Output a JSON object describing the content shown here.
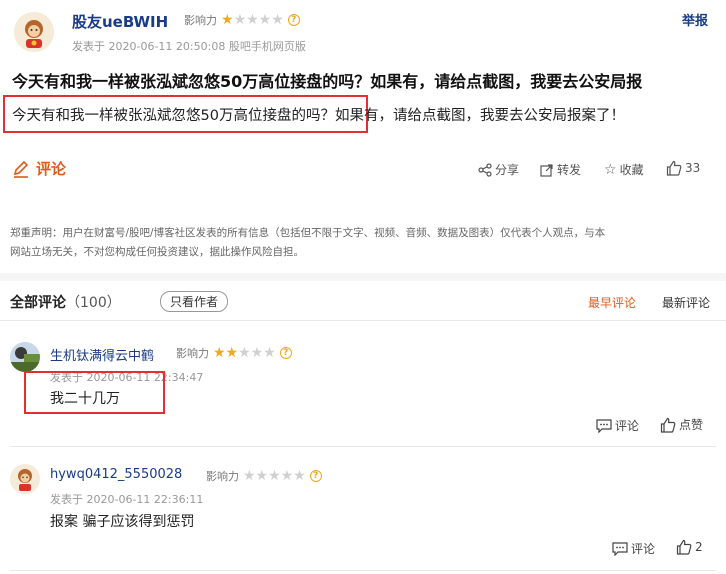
{
  "post": {
    "username": "股友ueBWIH",
    "influence_label": "影响力",
    "stars_on": 1,
    "stars_total": 5,
    "meta": "发表于 2020-06-11 20:50:08 股吧手机网页版",
    "report": "举报",
    "title": "今天有和我一样被张泓斌忽悠50万高位接盘的吗？如果有，请给点截图，我要去公安局报",
    "content_part1": "今天有和我一样被张泓斌忽悠50万高位接盘的吗？",
    "content_part2": "如果有，请给点截图，我要去公安局报案了！"
  },
  "actions": {
    "comment_label": "评论",
    "share": "分享",
    "repost": "转发",
    "favorite": "收藏",
    "like_count": "33"
  },
  "disclaimer": {
    "line1": "郑重声明：用户在财富号/股吧/博客社区发表的所有信息（包括但不限于文字、视频、音频、数据及图表）仅代表个人观点，与本",
    "line2": "网站立场无关，不对您构成任何投资建议，据此操作风险自担。"
  },
  "comments_header": {
    "title": "全部评论",
    "count": "（100）",
    "only_author": "只看作者",
    "sort_earliest": "最早评论",
    "sort_latest": "最新评论"
  },
  "comments": [
    {
      "username": "生机钛满得云中鹤",
      "influence_label": "影响力",
      "stars_on": 2,
      "meta": "发表于 2020-06-11 22:34:47",
      "text": "我二十几万",
      "reply": "评论",
      "like": "点赞"
    },
    {
      "username": "hywq0412_5550028",
      "influence_label": "影响力",
      "stars_on": 0,
      "meta": "发表于 2020-06-11 22:36:11",
      "text": "报案 骗子应该得到惩罚",
      "reply": "评论",
      "like": "2"
    }
  ],
  "colors": {
    "username": "#1a3b86",
    "accent": "#e05a1a",
    "star": "#f0a81c",
    "highlight_box": "#e03030"
  }
}
